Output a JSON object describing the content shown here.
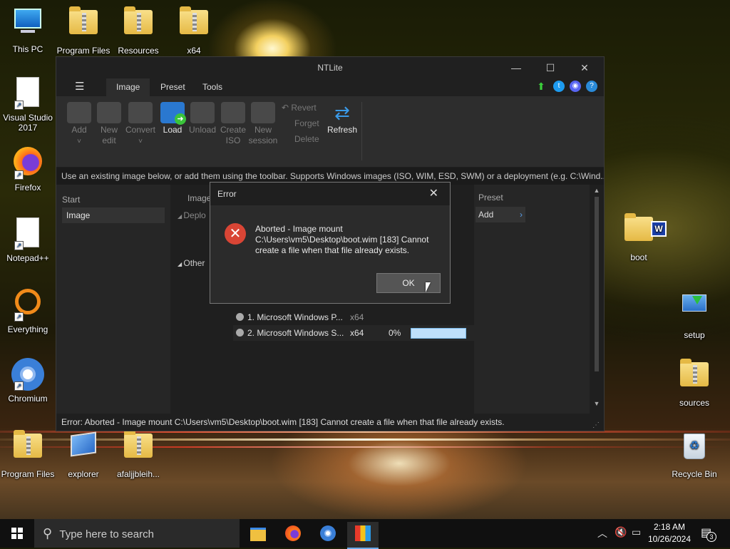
{
  "desktop": {
    "left_icons": [
      {
        "label": "This PC",
        "icon": "computer-icon"
      },
      {
        "label": "Visual Studio 2017",
        "icon": "document-icon"
      },
      {
        "label": "Firefox",
        "icon": "firefox-icon"
      },
      {
        "label": "Notepad++",
        "icon": "document-icon"
      },
      {
        "label": "Everything",
        "icon": "search-ring-icon"
      },
      {
        "label": "Chromium",
        "icon": "chromium-icon"
      },
      {
        "label": "Program Files",
        "icon": "folder-icon"
      }
    ],
    "top_icons": [
      {
        "label": "Program Files",
        "icon": "folder-icon"
      },
      {
        "label": "Resources",
        "icon": "folder-icon"
      },
      {
        "label": "x64",
        "icon": "folder-icon"
      }
    ],
    "bottom_icons": [
      {
        "label": "explorer",
        "icon": "explorer-icon"
      },
      {
        "label": "afaljjbleih...",
        "icon": "folder-icon"
      }
    ],
    "right_icons": [
      {
        "label": "boot",
        "icon": "folder-icon"
      },
      {
        "label": "setup",
        "icon": "setup-icon"
      },
      {
        "label": "sources",
        "icon": "folder-icon"
      },
      {
        "label": "Recycle Bin",
        "icon": "recycle-bin-icon"
      }
    ]
  },
  "window": {
    "title": "NTLite",
    "menu_tabs": [
      "Image",
      "Preset",
      "Tools"
    ],
    "ribbon": [
      {
        "label": "Add",
        "sub": "",
        "enabled": false
      },
      {
        "label": "New",
        "sub": "edit",
        "enabled": false
      },
      {
        "label": "Convert",
        "sub": "",
        "enabled": false
      },
      {
        "label": "Load",
        "sub": "",
        "enabled": true
      },
      {
        "label": "Unload",
        "sub": "",
        "enabled": false
      },
      {
        "label": "Create",
        "sub": "ISO",
        "enabled": false
      },
      {
        "label": "New",
        "sub": "session",
        "enabled": false
      }
    ],
    "ribbon_small": [
      "Revert",
      "Forget",
      "Delete"
    ],
    "refresh_label": "Refresh",
    "hint": "Use an existing image below, or add them using the toolbar. Supports Windows images (ISO, WIM, ESD, SWM) or a deployment (e.g. C:\\Wind...",
    "start_header": "Start",
    "start_item": "Image",
    "tree_header": "Image",
    "tree_items": [
      "Deplo",
      "Other"
    ],
    "images": [
      {
        "name": "1. Microsoft Windows P...",
        "arch": "x64",
        "progress_text": ""
      },
      {
        "name": "2. Microsoft Windows S...",
        "arch": "x64",
        "progress_text": "0%",
        "progress": 0
      }
    ],
    "preset_header": "Preset",
    "preset_item": "Add",
    "status": "Error: Aborted - Image mount C:\\Users\\vm5\\Desktop\\boot.wim  [183] Cannot create a file when that file already exists."
  },
  "dialog": {
    "title": "Error",
    "message_lines": [
      "Aborted - Image mount",
      "C:\\Users\\vm5\\Desktop\\boot.wim  [183] Cannot",
      "create a file when that file already exists."
    ],
    "ok_label": "OK"
  },
  "taskbar": {
    "search_placeholder": "Type here to search",
    "time": "2:18 AM",
    "date": "10/26/2024",
    "notification_count": "3"
  }
}
